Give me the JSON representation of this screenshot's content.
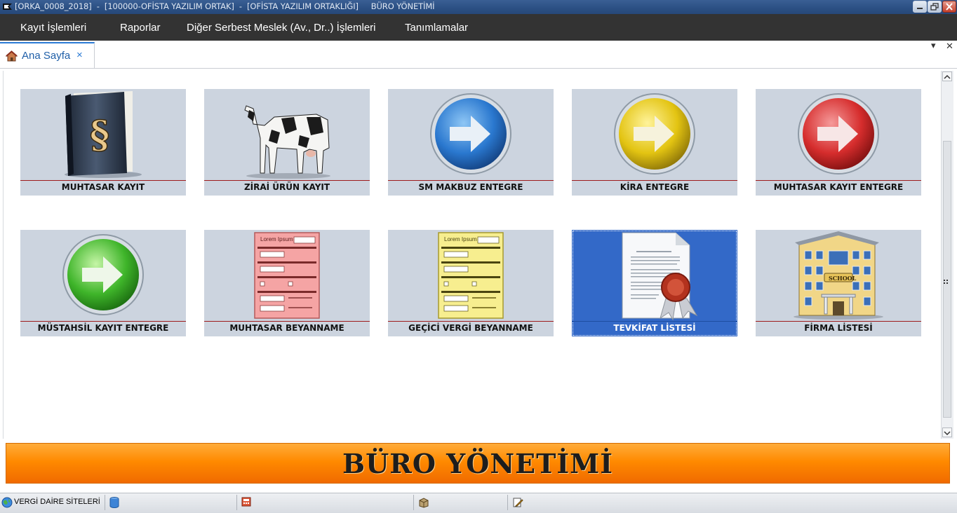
{
  "titlebar": {
    "text": "[ORKA_0008_2018]  -  [100000-OFİSTA YAZILIM ORTAK]  -  [OFİSTA YAZILIM ORTAKLIĞI]     BÜRO YÖNETİMİ"
  },
  "menu": {
    "items": [
      "Kayıt İşlemleri",
      "Raporlar",
      "Diğer Serbest Meslek (Av., Dr..) İşlemleri",
      "Tanımlamalar"
    ]
  },
  "tabs": {
    "active": {
      "label": "Ana Sayfa",
      "close": "×"
    },
    "dropdown": "▾",
    "close_all": "✕"
  },
  "tiles": [
    {
      "label": "MUHTASAR KAYIT",
      "icon": "law-book-icon"
    },
    {
      "label": "ZİRAİ ÜRÜN KAYIT",
      "icon": "cow-icon"
    },
    {
      "label": "SM MAKBUZ ENTEGRE",
      "icon": "blue-arrow-icon"
    },
    {
      "label": "KİRA ENTEGRE",
      "icon": "yellow-arrow-icon"
    },
    {
      "label": "MUHTASAR KAYIT ENTEGRE",
      "icon": "red-arrow-icon"
    },
    {
      "label": "MÜSTAHSİL KAYIT ENTEGRE",
      "icon": "green-arrow-icon"
    },
    {
      "label": "MUHTASAR BEYANNAME",
      "icon": "red-form-icon"
    },
    {
      "label": "GEÇİCİ VERGİ BEYANNAME",
      "icon": "yellow-form-icon"
    },
    {
      "label": "TEVKİFAT LİSTESİ",
      "icon": "certificate-icon",
      "selected": true
    },
    {
      "label": "FİRMA LİSTESİ",
      "icon": "school-building-icon"
    }
  ],
  "forms": {
    "heading": "Lorem Ipsum",
    "school_sign": "SCHOOL"
  },
  "banner": {
    "text": "BÜRO  YÖNETİMİ",
    "color": "#ff8a00"
  },
  "statusbar": {
    "first_label": "VERGİ DAİRE SİTELERİ"
  },
  "colors": {
    "titlebar": "#2b4f83",
    "menubar": "#333333",
    "tile_bg": "#ccd4df",
    "tile_selected": "#3369c8",
    "tab_accent": "#2b7bd5"
  }
}
